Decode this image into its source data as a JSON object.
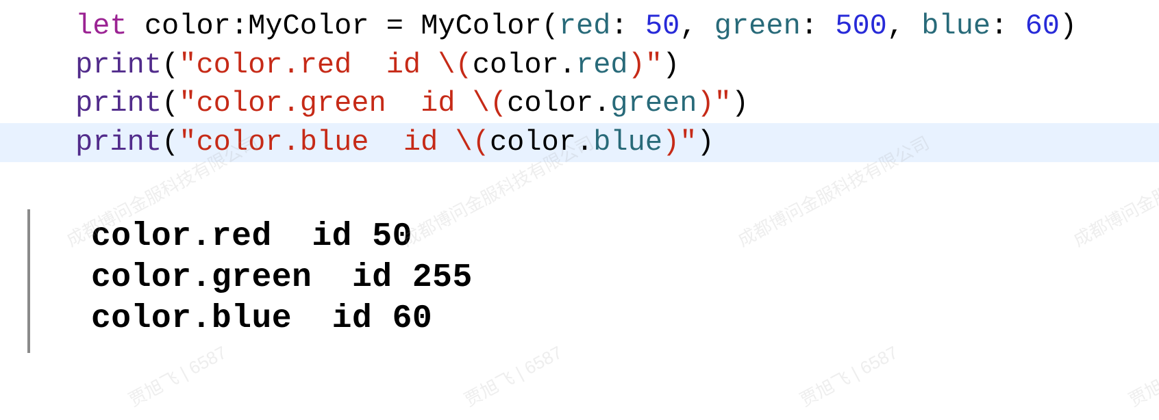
{
  "colors": {
    "keyword": "#9b2393",
    "string": "#c62a17",
    "number": "#272ad8",
    "call": "#512b8b",
    "param": "#286a79",
    "highlight": "#e8f2ff"
  },
  "code": {
    "l1": {
      "kw_let": "let",
      "sp1": " ",
      "id_color": "color",
      "colon": ":",
      "type": "MyColor",
      "sp2": " ",
      "eq": "=",
      "sp3": " ",
      "ctor": "MyColor",
      "op": "(",
      "p_red": "red",
      "c1": ":",
      "sp4": " ",
      "n_red": "50",
      "comma1": ",",
      "sp5": " ",
      "p_green": "green",
      "c2": ":",
      "sp6": " ",
      "n_green": "500",
      "comma2": ",",
      "sp7": " ",
      "p_blue": "blue",
      "c3": ":",
      "sp8": " ",
      "n_blue": "60",
      "cp": ")"
    },
    "l2": {
      "fn": "print",
      "op": "(",
      "q1": "\"",
      "s1": "color.red  id ",
      "esc": "\\(",
      "obj": "color",
      "dot": ".",
      "prop": "red",
      "escc": ")",
      "q2": "\"",
      "cp": ")"
    },
    "l3": {
      "fn": "print",
      "op": "(",
      "q1": "\"",
      "s1": "color.green  id ",
      "esc": "\\(",
      "obj": "color",
      "dot": ".",
      "prop": "green",
      "escc": ")",
      "q2": "\"",
      "cp": ")"
    },
    "l4": {
      "fn": "print",
      "op": "(",
      "q1": "\"",
      "s1": "color.blue  id ",
      "esc": "\\(",
      "obj": "color",
      "dot": ".",
      "prop": "blue",
      "escc": ")",
      "q2": "\"",
      "cp": ")"
    }
  },
  "output": {
    "l1": "color.red  id 50",
    "l2": "color.green  id 255",
    "l3": "color.blue  id 60"
  },
  "watermark": {
    "company": "成都博问金服科技有限公司",
    "user": "贾旭飞 | 6587"
  }
}
